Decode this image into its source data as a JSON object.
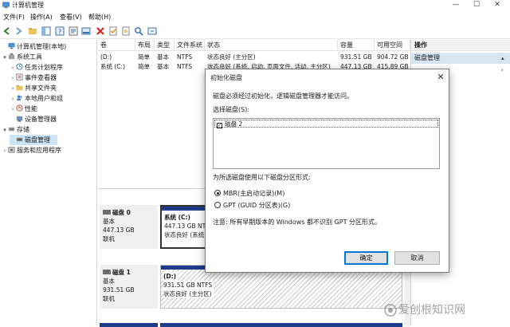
{
  "window": {
    "title": "计算机管理"
  },
  "menu": [
    "文件(F)",
    "操作(A)",
    "查看(V)",
    "帮助(H)"
  ],
  "tree": {
    "items": [
      {
        "label": "计算机管理(本地)",
        "icon": "computer-icon",
        "level": 0,
        "expander": ""
      },
      {
        "label": "系统工具",
        "icon": "tools-icon",
        "level": 1,
        "expander": "▾"
      },
      {
        "label": "任务计划程序",
        "icon": "clock-icon",
        "level": 2,
        "expander": "›"
      },
      {
        "label": "事件查看器",
        "icon": "event-icon",
        "level": 2,
        "expander": "›"
      },
      {
        "label": "共享文件夹",
        "icon": "folder-icon",
        "level": 2,
        "expander": "›"
      },
      {
        "label": "本地用户和组",
        "icon": "users-icon",
        "level": 2,
        "expander": "›"
      },
      {
        "label": "性能",
        "icon": "performance-icon",
        "level": 2,
        "expander": "›"
      },
      {
        "label": "设备管理器",
        "icon": "device-icon",
        "level": 2,
        "expander": ""
      },
      {
        "label": "存储",
        "icon": "storage-icon",
        "level": 1,
        "expander": "▾"
      },
      {
        "label": "磁盘管理",
        "icon": "disk-icon",
        "level": 2,
        "expander": "",
        "selected": true
      },
      {
        "label": "服务和应用程序",
        "icon": "services-icon",
        "level": 1,
        "expander": "›"
      }
    ]
  },
  "volume_table": {
    "headers": [
      "卷",
      "布局",
      "类型",
      "文件系统",
      "状态",
      "容量",
      "可用空间"
    ],
    "rows": [
      [
        "(D:)",
        "简单",
        "基本",
        "NTFS",
        "状态良好 (主分区)",
        "931.51 GB",
        "904.72 GB"
      ],
      [
        "系统 (C:)",
        "简单",
        "基本",
        "NTFS",
        "状态良好 (系统, 启动, 页面文件, 活动, 主分区)",
        "447.13 GB",
        "415.89 GB"
      ]
    ]
  },
  "actions": {
    "header": "操作",
    "item": "磁盘管理"
  },
  "disks": [
    {
      "name": "磁盘 0",
      "type": "基本",
      "size": "447.13 GB",
      "status": "联机",
      "partition": {
        "label": "系统 (C:)",
        "detail": "447.13 GB NTFS",
        "status": "状态良好 (系统"
      }
    },
    {
      "name": "磁盘 1",
      "type": "基本",
      "size": "931.51 GB",
      "status": "联机",
      "partition": {
        "label": "(D:)",
        "detail": "931.51 GB NTFS",
        "status": "状态良好 (主分区)"
      }
    }
  ],
  "dialog": {
    "title": "初始化磁盘",
    "intro": "磁盘必须经过初始化，逻辑磁盘管理器才能访问。",
    "select_label": "选择磁盘(S):",
    "disk_item": "磁盘 2",
    "style_label": "为所选磁盘使用以下磁盘分区形式:",
    "option_mbr": "MBR(主启动记录)(M)",
    "option_gpt": "GPT (GUID 分区表)(G)",
    "note": "注意: 所有早期版本的 Windows 都不识别 GPT 分区形式。",
    "ok": "确定",
    "cancel": "取消"
  },
  "watermark": "爱创根知识网"
}
